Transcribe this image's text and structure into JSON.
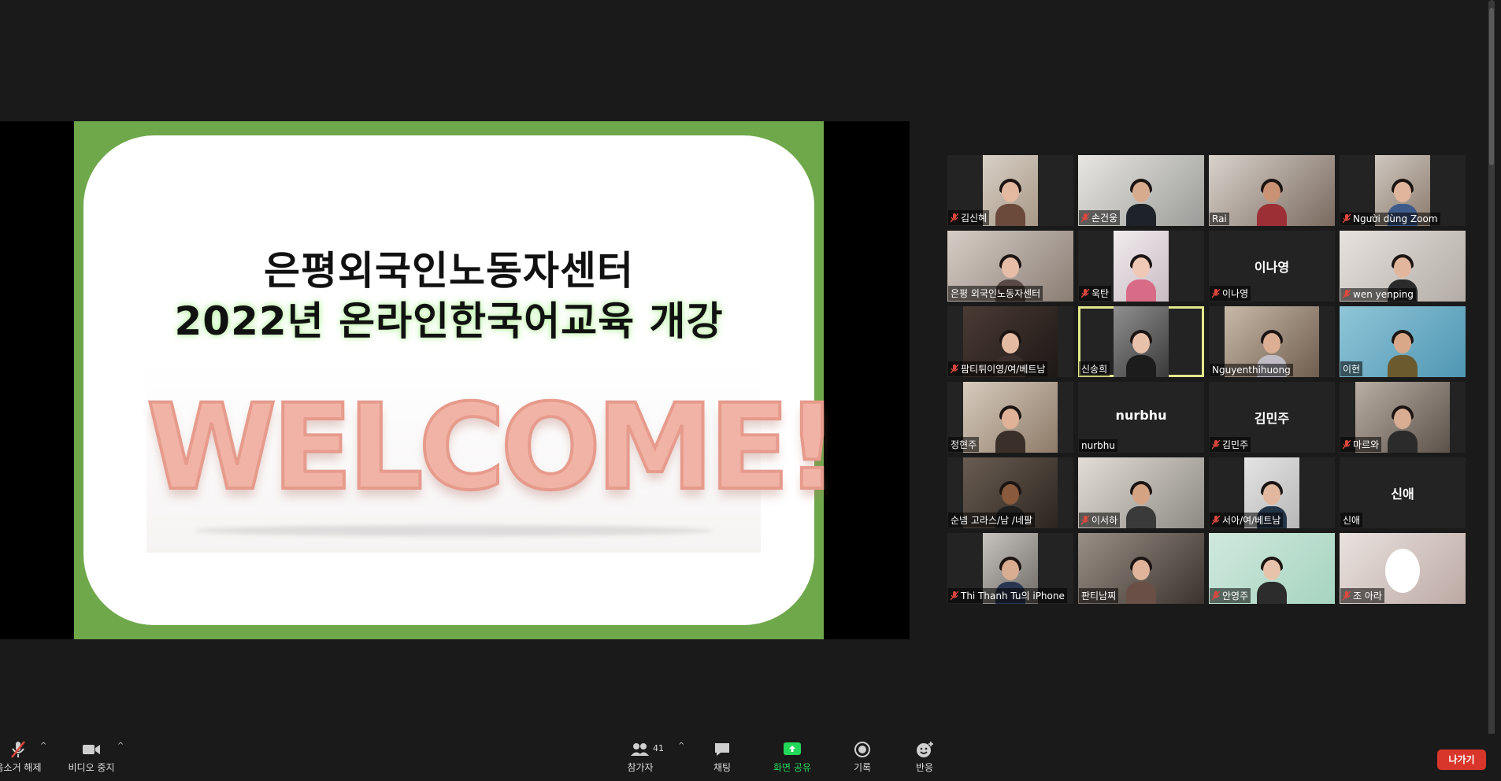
{
  "slide": {
    "title_line1": "은평외국인노동자센터",
    "title_line2": "2022년 온라인한국어교육 개강",
    "welcome_text": "WELCOME!"
  },
  "gallery": [
    {
      "name": "김신혜",
      "muted": true,
      "video": true
    },
    {
      "name": "손건웅",
      "muted": true,
      "video": true
    },
    {
      "name": "Rai",
      "muted": false,
      "video": true
    },
    {
      "name": "Người dùng Zoom",
      "muted": true,
      "video": true
    },
    {
      "name": "은평 외국인노동자센터",
      "muted": false,
      "video": true
    },
    {
      "name": "욱탄",
      "muted": true,
      "video": true
    },
    {
      "name": "이나영",
      "muted": true,
      "video": false
    },
    {
      "name": "wen yenping",
      "muted": true,
      "video": true
    },
    {
      "name": "팜티튀이영/여/베트남",
      "muted": true,
      "video": true
    },
    {
      "name": "신송희",
      "muted": false,
      "video": true,
      "speaking": true
    },
    {
      "name": "Nguyenthihuong",
      "muted": false,
      "video": true
    },
    {
      "name": "이현",
      "muted": false,
      "video": true
    },
    {
      "name": "정현주",
      "muted": false,
      "video": true
    },
    {
      "name": "nurbhu",
      "muted": false,
      "video": false
    },
    {
      "name": "김민주",
      "muted": true,
      "video": false
    },
    {
      "name": "마르와",
      "muted": true,
      "video": true
    },
    {
      "name": "순넴 고라스/남 /네팔",
      "muted": false,
      "video": true
    },
    {
      "name": "이서하",
      "muted": true,
      "video": true
    },
    {
      "name": "서아/여/베트남",
      "muted": true,
      "video": true
    },
    {
      "name": "신애",
      "muted": false,
      "video": false
    },
    {
      "name": "Thi Thanh Tu의 iPhone",
      "muted": true,
      "video": true
    },
    {
      "name": "판티남찌",
      "muted": false,
      "video": true
    },
    {
      "name": "안영주",
      "muted": true,
      "video": true
    },
    {
      "name": "조 아라",
      "muted": true,
      "video": true
    }
  ],
  "toolbar": {
    "unmute_label": "음소거 해제",
    "stop_video_label": "비디오 중지",
    "participants_label": "참가자",
    "participant_count": "41",
    "chat_label": "채팅",
    "share_screen_label": "화면 공유",
    "record_label": "기록",
    "reactions_label": "반응",
    "leave_label": "나가기"
  },
  "colors": {
    "slide_border": "#6fa84b",
    "share_button": "#23d959",
    "leave_button": "#d9362b",
    "speaking_highlight": "#e3e98b",
    "mute_icon": "#e0483e"
  }
}
